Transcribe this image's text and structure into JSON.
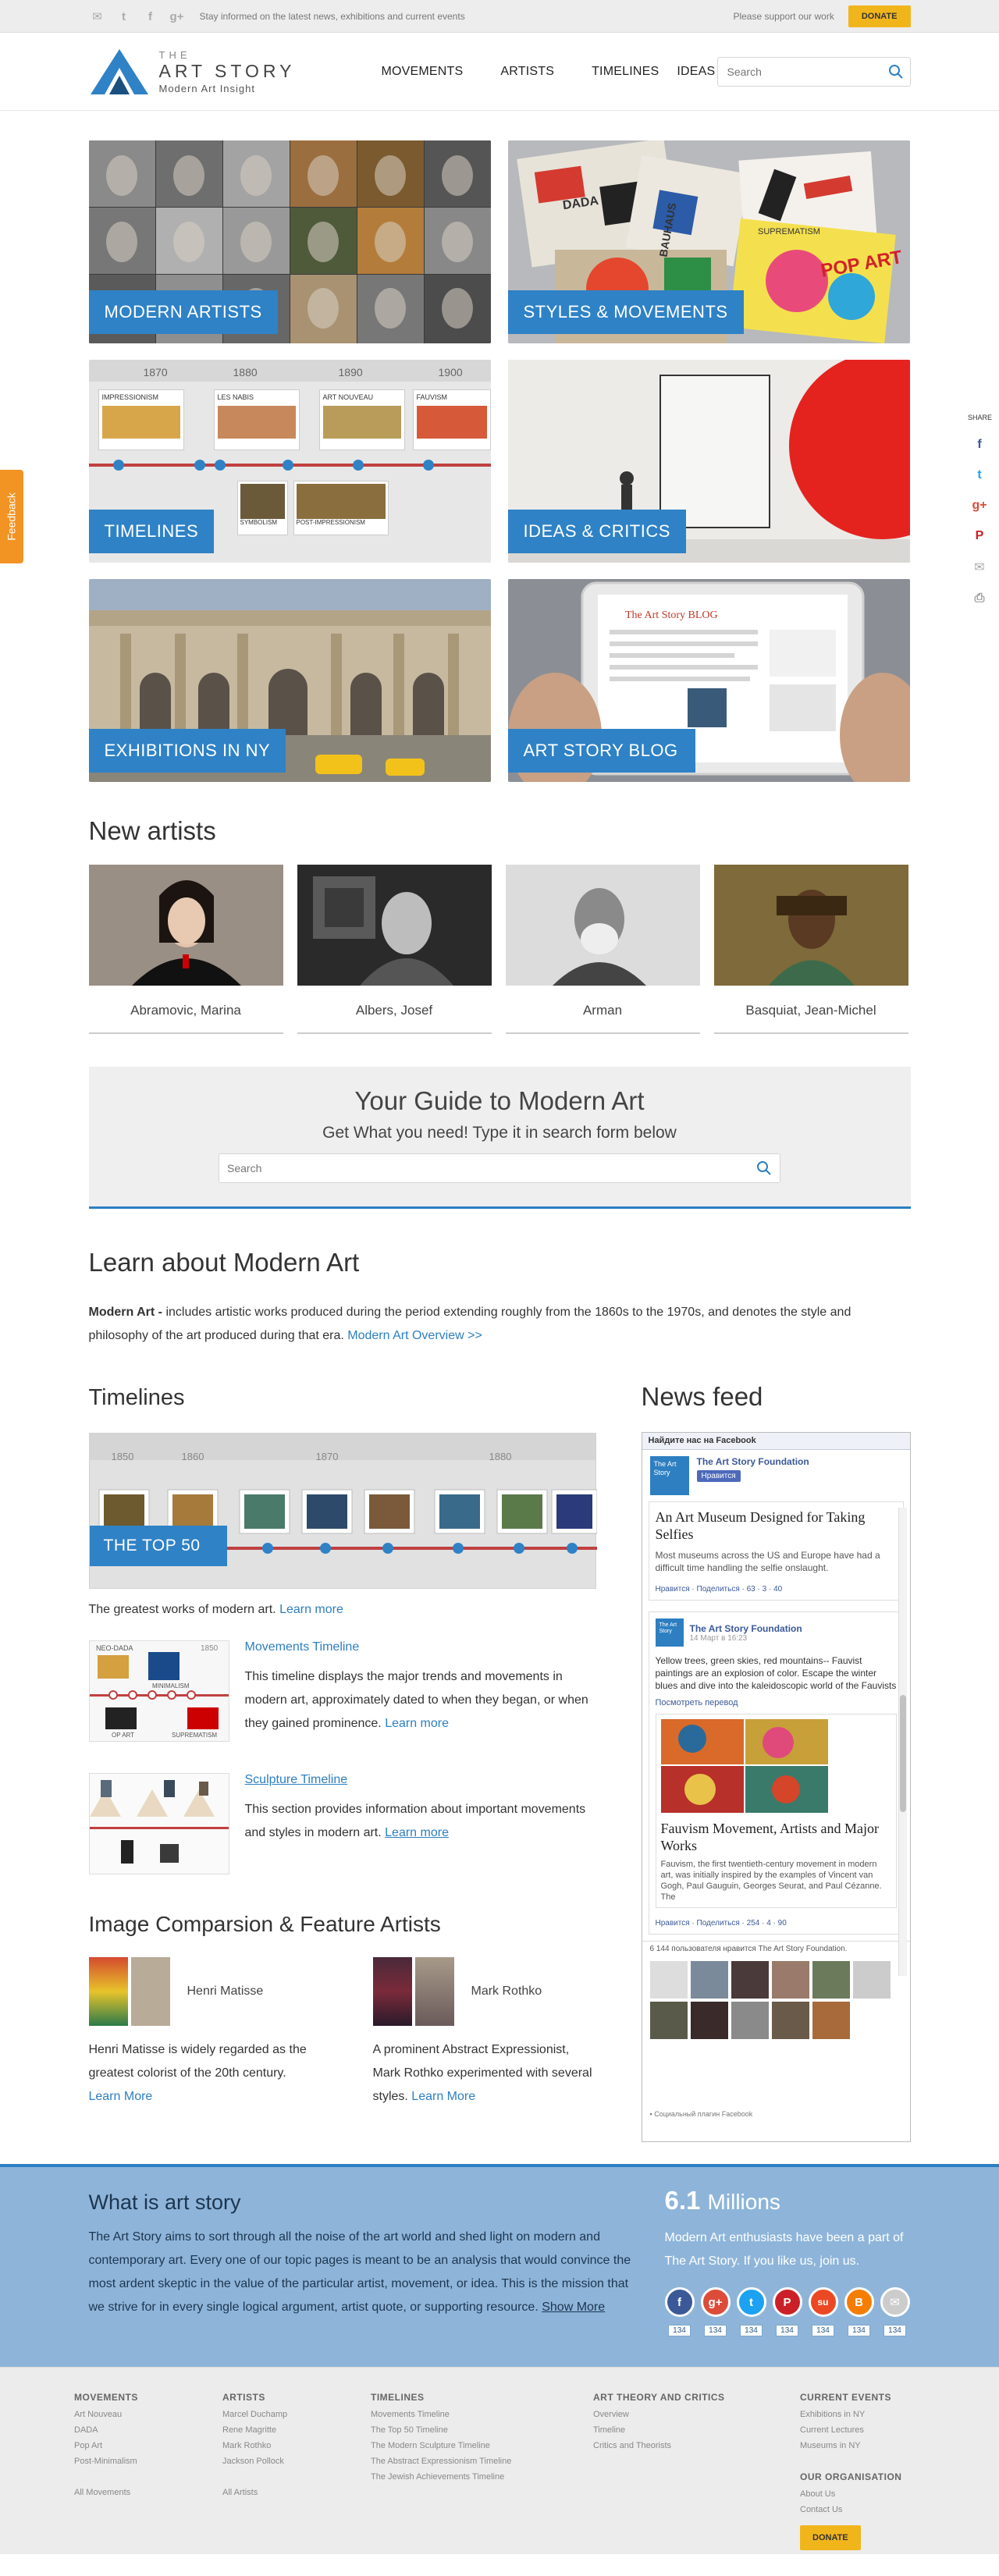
{
  "topbar": {
    "stay": "Stay informed on the latest news, exhibitions and current events",
    "support": "Please support our work",
    "donate": "DONATE"
  },
  "header": {
    "logo_the": "THE",
    "logo_name": "ART STORY",
    "logo_sub": "Modern Art Insight",
    "nav": [
      "MOVEMENTS",
      "ARTISTS",
      "TIMELINES",
      "IDEAS"
    ],
    "search_placeholder": "Search"
  },
  "tiles": [
    "MODERN ARTISTS",
    "STYLES & MOVEMENTS",
    "TIMELINES",
    "IDEAS & CRITICS",
    "EXHIBITIONS IN NY",
    "ART STORY BLOG"
  ],
  "tile_timeline": {
    "years": [
      "1870",
      "1880",
      "1890",
      "1900"
    ],
    "cards_top": [
      "IMPRESSIONISM",
      "LES NABIS",
      "ART NOUVEAU",
      "FAUVISM"
    ],
    "cards_bottom": [
      "SYMBOLISM",
      "POST-IMPRESSIONISM"
    ]
  },
  "tile_movements_texts": [
    "DADA",
    "BAUHAUS",
    "SUPREMATISM",
    "POP ART"
  ],
  "blog_title": "The Art Story BLOG",
  "new_artists": {
    "title": "New artists",
    "items": [
      "Abramovic, Marina",
      "Albers, Josef",
      "Arman",
      "Basquiat, Jean-Michel"
    ]
  },
  "guide": {
    "title": "Your Guide to Modern Art",
    "subtitle": "Get What you need!  Type it in search form below",
    "placeholder": "Search"
  },
  "learn": {
    "title": "Learn about Modern Art",
    "term": "Modern Art -",
    "text": " includes artistic works produced during the period extending roughly from the 1860s to the 1970s, and denotes the style and philosophy of the art produced during that era. ",
    "link": "Modern Art Overview >>"
  },
  "timelines": {
    "title": "Timelines",
    "years": [
      "1850",
      "1860",
      "1870",
      "1880"
    ],
    "top50": "THE TOP 50",
    "caption": "The greatest works of modern art.",
    "caption_link": "Learn more",
    "movements": {
      "title": "Movements Timeline",
      "desc": "This timeline displays the major trends and movements in modern art, approximately dated to when they began, or when they gained prominence.",
      "link": "Learn more",
      "thumb_year": "1850",
      "thumb_labels": [
        "NEO-DADA",
        "MINIMALISM",
        "OP ART",
        "SUPREMATISM"
      ]
    },
    "sculpture": {
      "title": "Sculpture Timeline",
      "desc": "This section provides information about important movements and styles in modern art.",
      "link": "Learn more"
    }
  },
  "compare": {
    "title": "Image Comparsion & Feature Artists",
    "items": [
      {
        "name": "Henri Matisse",
        "desc": "Henri Matisse is widely regarded as the greatest colorist of the 20th century.",
        "link": "Learn More"
      },
      {
        "name": "Mark Rothko",
        "desc": "A prominent Abstract Expressionist, Mark Rothko experimented with several styles.",
        "link": "Learn More"
      }
    ]
  },
  "feed": {
    "title": "News feed",
    "fb_header": "Найдите нас на Facebook",
    "page_name": "The Art Story Foundation",
    "like": "Нравится",
    "logo_text": "The Art Story",
    "post1": {
      "title": "An Art Museum Designed for Taking Selfies",
      "text": "Most museums across the US and Europe have had a difficult time handling the selfie onslaught.",
      "meta": "Нравится · Поделиться · 63 · 3 · 40"
    },
    "post2": {
      "page": "The Art Story Foundation",
      "date": "14 Март в 16:23",
      "text": "Yellow trees, green skies, red mountains-- Fauvist paintings are an explosion of color. Escape the winter blues and dive into the kaleidoscopic world of the Fauvists",
      "translate": "Посмотреть перевод",
      "title": "Fauvism Movement, Artists and Major Works",
      "desc": "Fauvism, the first twentieth-century movement in modern art, was initially inspired by the examples of Vincent van Gogh, Paul Gauguin, Georges Seurat, and Paul Cézanne. The",
      "meta": "Нравится · Поделиться · 254 · 4 · 90"
    },
    "likes": "6 144 пользователя нравится The Art Story Foundation.",
    "plugin": "Социальный плагин Facebook"
  },
  "about": {
    "title": "What is art story",
    "text": "The Art Story aims to sort through all the noise of the art world and shed light on modern and contemporary art. Every one of our topic pages is meant to be an analysis that would convince the most ardent skeptic in the value of the particular artist, movement, or idea. This is the mission that we strive for in every single logical argument, artist quote, or supporting resource.",
    "more": "Show More",
    "big_num": "6.1",
    "big_unit": "Millions",
    "right_text": "Modern Art enthusiasts have been a part of The Art Story. If you like us, join us.",
    "shares": [
      {
        "icon": "facebook-icon",
        "color": "#3b5998",
        "glyph": "f",
        "count": "134"
      },
      {
        "icon": "googleplus-icon",
        "color": "#dd4b39",
        "glyph": "g+",
        "count": "134"
      },
      {
        "icon": "twitter-icon",
        "color": "#1da1f2",
        "glyph": "t",
        "count": "134"
      },
      {
        "icon": "pinterest-icon",
        "color": "#cb2027",
        "glyph": "P",
        "count": "134"
      },
      {
        "icon": "stumble-icon",
        "color": "#eb4924",
        "glyph": "su",
        "count": "134"
      },
      {
        "icon": "blogger-icon",
        "color": "#f57d00",
        "glyph": "B",
        "count": "134"
      },
      {
        "icon": "email-icon",
        "color": "#cccccc",
        "glyph": "✉",
        "count": "134"
      }
    ]
  },
  "footer": {
    "cols": [
      {
        "title": "MOVEMENTS",
        "items": [
          "Art Nouveau",
          "DADA",
          "Pop Art",
          "Post-Minimalism"
        ],
        "all": "All Movements"
      },
      {
        "title": "ARTISTS",
        "items": [
          "Marcel Duchamp",
          "Rene Magritte",
          "Mark Rothko",
          "Jackson Pollock"
        ],
        "all": "All Artists"
      },
      {
        "title": "TIMELINES",
        "items": [
          "Movements Timeline",
          "The Top 50 Timeline",
          "The Modern Sculpture Timeline",
          "The Abstract Expressionism Timeline",
          "The Jewish Achievements Timeline"
        ]
      },
      {
        "title": "ART THEORY AND CRITICS",
        "items": [
          "Overview",
          "Timeline",
          "Critics and Theorists"
        ]
      },
      {
        "title": "CURRENT EVENTS",
        "items": [
          "Exhibitions in NY",
          "Current Lectures",
          "Museums in NY"
        ],
        "title2": "OUR ORGANISATION",
        "items2": [
          "About Us",
          "Contact Us"
        ],
        "donate": "DONATE"
      }
    ]
  },
  "side": {
    "feedback": "Feedback",
    "share": "SHARE"
  },
  "colors": {
    "accent": "#2f82c6",
    "donate": "#f1b51c",
    "feedback": "#f29423",
    "about_bg": "#8eb5d9"
  }
}
